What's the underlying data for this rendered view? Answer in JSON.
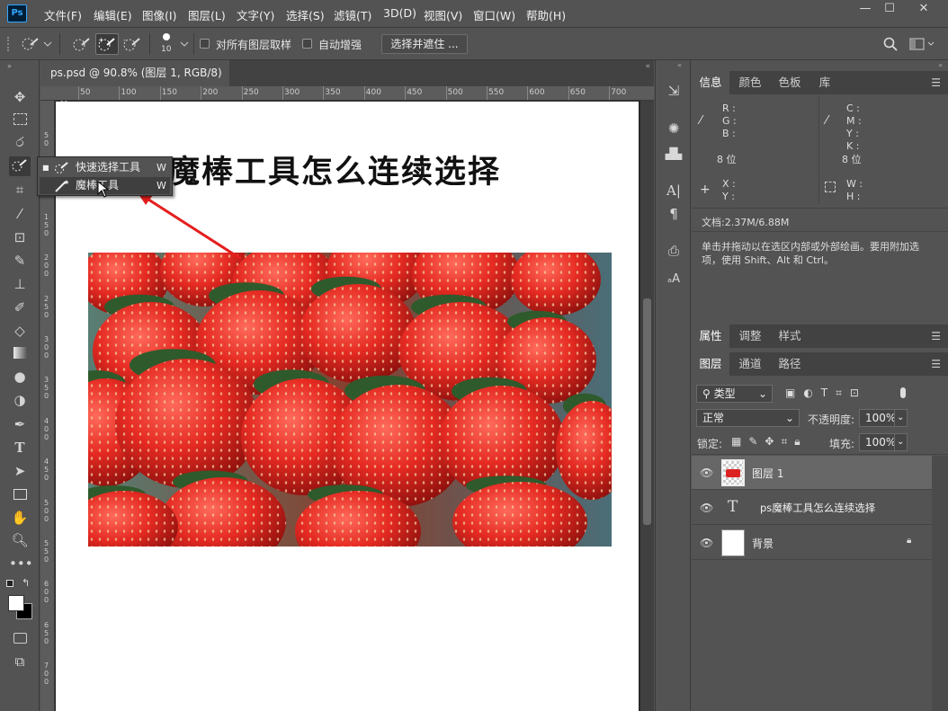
{
  "app": {
    "logo": "Ps"
  },
  "menu": [
    "文件(F)",
    "编辑(E)",
    "图像(I)",
    "图层(L)",
    "文字(Y)",
    "选择(S)",
    "滤镜(T)",
    "3D(D)",
    "视图(V)",
    "窗口(W)",
    "帮助(H)"
  ],
  "window_controls": {
    "minimize": "—",
    "restore": "☐",
    "close": "✕"
  },
  "options_bar": {
    "brush_size": "10",
    "sample_all_layers": "对所有图层取样",
    "auto_enhance": "自动增强",
    "select_and_mask": "选择并遮住 ..."
  },
  "document": {
    "tab_title": "ps.psd @ 90.8% (图层 1, RGB/8)",
    "tab_close": "×",
    "heading_text": "魔棒工具怎么连续选择",
    "ruler_h": [
      "50",
      "100",
      "150",
      "200",
      "250",
      "300",
      "350",
      "400",
      "450",
      "500",
      "550",
      "600",
      "650",
      "700"
    ],
    "ruler_v": [
      "5\n0",
      "1\n0\n0",
      "1\n5\n0",
      "2\n0\n0",
      "2\n5\n0",
      "3\n0\n0",
      "3\n5\n0",
      "4\n0\n0",
      "4\n5\n0",
      "5\n0\n0",
      "5\n5\n0",
      "6\n0\n0",
      "6\n5\n0",
      "7\n0\n0"
    ]
  },
  "tool_flyout": {
    "items": [
      {
        "label": "快速选择工具",
        "shortcut": "W"
      },
      {
        "label": "魔棒工具",
        "shortcut": "W"
      }
    ]
  },
  "info_panel": {
    "tabs": [
      "信息",
      "颜色",
      "色板",
      "库"
    ],
    "rgb": [
      "R :",
      "G :",
      "B :"
    ],
    "cmyk": [
      "C :",
      "M :",
      "Y :",
      "K :"
    ],
    "bits_left": "8 位",
    "bits_right": "8 位",
    "xy": [
      "X :",
      "Y :"
    ],
    "wh": [
      "W :",
      "H :"
    ],
    "doc_size": "文档:2.37M/6.88M",
    "hint": "单击并拖动以在选区内部或外部绘画。要用附加选项，使用 Shift、Alt 和 Ctrl。"
  },
  "props_panel": {
    "tabs": [
      "属性",
      "调整",
      "样式"
    ]
  },
  "layers_panel": {
    "tabs": [
      "图层",
      "通道",
      "路径"
    ],
    "filter_kind": "类型",
    "blend_mode": "正常",
    "opacity_label": "不透明度:",
    "opacity_value": "100%",
    "lock_label": "锁定:",
    "fill_label": "填充:",
    "fill_value": "100%",
    "layers": [
      {
        "name": "图层 1",
        "selected": true
      },
      {
        "name": "ps魔棒工具怎么连续选择",
        "selected": false
      },
      {
        "name": "背景",
        "selected": false
      }
    ]
  },
  "colors": {
    "accent_red": "#e61e1e",
    "ps_blue": "#31a8ff"
  }
}
